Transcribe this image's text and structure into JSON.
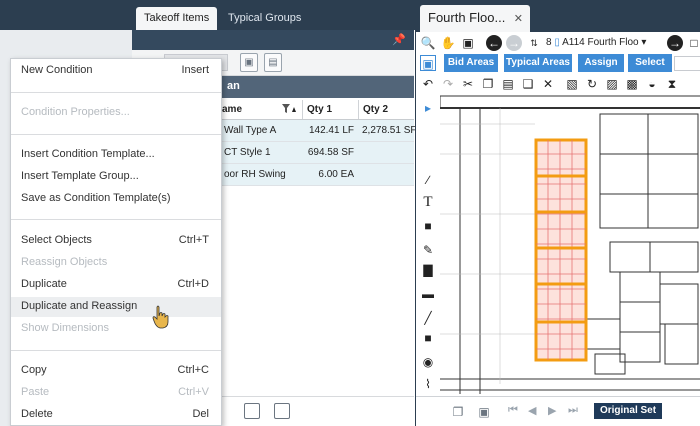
{
  "takeoff": {
    "tabs": [
      "Takeoff Items",
      "Typical Groups"
    ],
    "group_header": "an",
    "columns": [
      "ame",
      "Qty 1",
      "Qty 2"
    ],
    "rows": [
      {
        "name": "Wall Type A",
        "qty1": "142.41 LF",
        "qty2": "2,278.51 SF"
      },
      {
        "name": "CT Style 1",
        "qty1": "694.58 SF",
        "qty2": ""
      },
      {
        "name": "oor RH Swing",
        "qty1": "6.00 EA",
        "qty2": ""
      }
    ]
  },
  "context_menu": {
    "items": [
      {
        "label": "New Condition",
        "shortcut": "Insert",
        "disabled": false
      },
      {
        "label": "Condition Properties...",
        "shortcut": "",
        "disabled": true
      },
      {
        "label": "Insert Condition Template...",
        "shortcut": "",
        "disabled": false
      },
      {
        "label": "Insert Template Group...",
        "shortcut": "",
        "disabled": false
      },
      {
        "label": "Save as Condition Template(s)",
        "shortcut": "",
        "disabled": false
      },
      {
        "label": "Select Objects",
        "shortcut": "Ctrl+T",
        "disabled": false
      },
      {
        "label": "Reassign Objects",
        "shortcut": "",
        "disabled": true
      },
      {
        "label": "Duplicate",
        "shortcut": "Ctrl+D",
        "disabled": false
      },
      {
        "label": "Duplicate and Reassign",
        "shortcut": "",
        "disabled": false,
        "hover": true
      },
      {
        "label": "Show Dimensions",
        "shortcut": "",
        "disabled": true
      },
      {
        "label": "Copy",
        "shortcut": "Ctrl+C",
        "disabled": false
      },
      {
        "label": "Paste",
        "shortcut": "Ctrl+V",
        "disabled": true
      },
      {
        "label": "Delete",
        "shortcut": "Del",
        "disabled": false
      }
    ]
  },
  "viewer": {
    "tab_title": "Fourth Floo...",
    "page_number": "8",
    "page_name": "A114 Fourth Floo",
    "buttons": [
      "Bid Areas",
      "Typical Areas",
      "Assign",
      "Select"
    ],
    "bottom_button": "Original Set"
  },
  "colors": {
    "dark_header": "#2c3e50",
    "accent_blue": "#3d8bd6",
    "highlight_orange": "#f39c12"
  }
}
